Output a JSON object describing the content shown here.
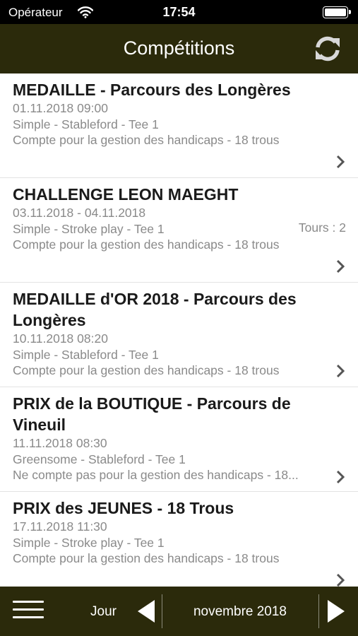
{
  "status_bar": {
    "carrier": "Opérateur",
    "time": "17:54",
    "icons": [
      "wifi-icon",
      "battery-icon"
    ]
  },
  "header": {
    "title": "Compétitions",
    "refresh_icon": "refresh-icon"
  },
  "competitions": [
    {
      "name": "MEDAILLE - Parcours des Longères",
      "date": "01.11.2018 09:00",
      "format": "Simple - Stableford - Tee 1",
      "rounds": "",
      "handicap": "Compte pour la gestion des handicaps - 18 trous"
    },
    {
      "name": "CHALLENGE LEON MAEGHT",
      "date": "03.11.2018 - 04.11.2018",
      "format": "Simple - Stroke play - Tee 1",
      "rounds": "Tours : 2",
      "handicap": "Compte pour la gestion des handicaps - 18 trous"
    },
    {
      "name": "MEDAILLE d'OR 2018 - Parcours des Longères",
      "date": "10.11.2018 08:20",
      "format": "Simple - Stableford - Tee 1",
      "rounds": "",
      "handicap": "Compte pour la gestion des handicaps - 18 trous"
    },
    {
      "name": "PRIX de la BOUTIQUE - Parcours de Vineuil",
      "date": "11.11.2018 08:30",
      "format": "Greensome - Stableford - Tee 1",
      "rounds": "",
      "handicap": "Ne compte pas pour la gestion des handicaps - 18..."
    },
    {
      "name": "PRIX des JEUNES - 18 Trous",
      "date": "17.11.2018 11:30",
      "format": "Simple - Stroke play - Tee 1",
      "rounds": "",
      "handicap": "Compte pour la gestion des handicaps - 18 trous"
    }
  ],
  "footer": {
    "menu_icon": "hamburger-menu-icon",
    "period_label": "Jour",
    "prev_icon": "triangle-left-icon",
    "month": "novembre 2018",
    "next_icon": "triangle-right-icon"
  },
  "colors": {
    "bar_background": "#2b2a0b",
    "title_text": "#1a1a1a",
    "detail_text": "#8a8a8a"
  }
}
